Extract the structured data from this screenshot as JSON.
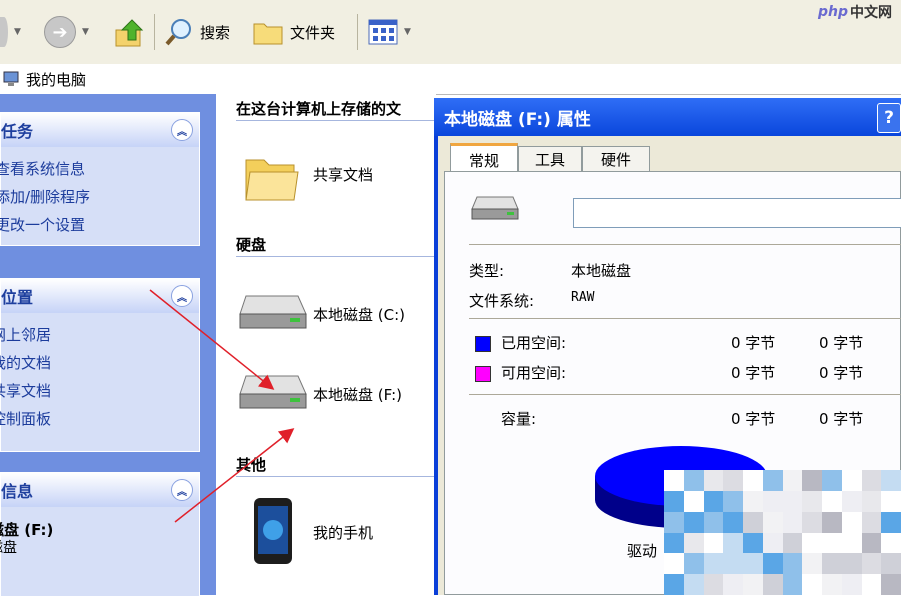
{
  "toolbar": {
    "search_label": "搜索",
    "folders_label": "文件夹"
  },
  "address": {
    "location": "我的电脑"
  },
  "leftpane": {
    "tasks": {
      "title": "任务",
      "items": [
        "查看系统信息",
        "添加/删除程序",
        "更改一个设置"
      ]
    },
    "places": {
      "title": "位置",
      "items": [
        "网上邻居",
        "我的文档",
        "共享文档",
        "控制面板"
      ]
    },
    "details": {
      "title": "信息",
      "line1": "磁盘 (F:)",
      "line2": "磁盘"
    }
  },
  "main": {
    "header": "在这台计算机上存储的文",
    "shared_docs": "共享文档",
    "disks_title": "硬盘",
    "disk_c": "本地磁盘 (C:)",
    "disk_f": "本地磁盘 (F:)",
    "other_title": "其他",
    "my_phone": "我的手机"
  },
  "dialog": {
    "title": "本地磁盘 (F:) 属性",
    "help": "?",
    "tabs": [
      "常规",
      "工具",
      "硬件"
    ],
    "name_value": "",
    "type_label": "类型:",
    "type_value": "本地磁盘",
    "fs_label": "文件系统:",
    "fs_value": "RAW",
    "used_label": "已用空间:",
    "used_bytes": "0 字节",
    "used_size": "0 字节",
    "free_label": "可用空间:",
    "free_bytes": "0 字节",
    "free_size": "0 字节",
    "capacity_label": "容量:",
    "capacity_bytes": "0 字节",
    "capacity_size": "0 字节",
    "drive_label": "驱动",
    "colors": {
      "used": "#0000ff",
      "free": "#ff00ff"
    }
  },
  "watermark": {
    "brand": "php",
    "text": "中文网"
  }
}
